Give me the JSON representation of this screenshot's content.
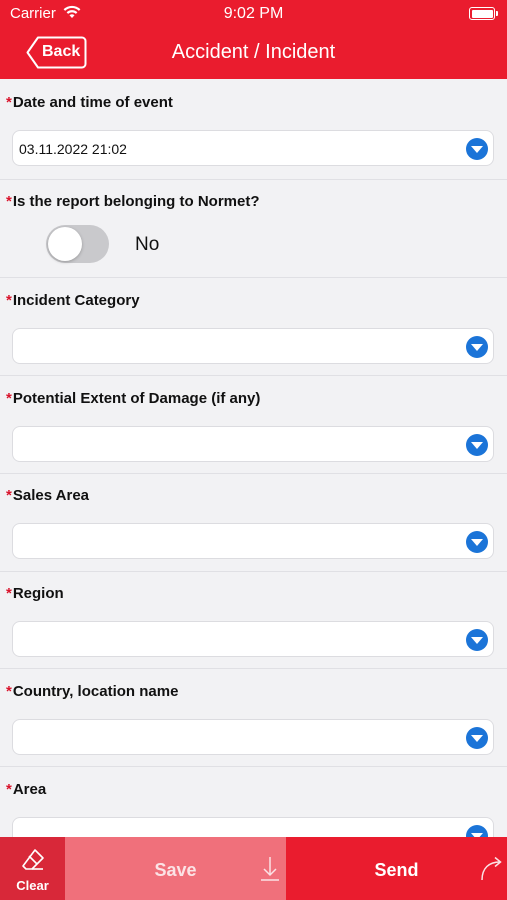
{
  "status_bar": {
    "carrier": "Carrier",
    "time": "9:02 PM"
  },
  "header": {
    "back_label": "Back",
    "title": "Accident / Incident",
    "color": "#ea1c2e"
  },
  "form": {
    "required_marker": "*",
    "date_label": "Date and time of event",
    "date_value": "03.11.2022 21:02",
    "normet_label": "Is the report belonging to Normet?",
    "normet_toggle_value": "No",
    "category_label": "Incident Category",
    "category_value": "",
    "damage_label": "Potential Extent of Damage (if any)",
    "damage_value": "",
    "sales_area_label": "Sales Area",
    "sales_area_value": "",
    "region_label": "Region",
    "region_value": "",
    "country_label": "Country, location name",
    "country_value": "",
    "area_label": "Area",
    "area_value": ""
  },
  "bottom_bar": {
    "clear_label": "Clear",
    "save_label": "Save",
    "send_label": "Send"
  },
  "icons": {
    "wifi": "wifi-icon",
    "battery": "battery-icon",
    "dropdown": "chevron-down-circle-icon",
    "clear": "eraser-icon",
    "save": "download-arrow-icon",
    "send": "curved-arrow-icon"
  },
  "colors": {
    "accent": "#ea1c2e",
    "dropdown": "#1b74d8",
    "required": "#d9132b",
    "save_bg": "#f0707b",
    "clear_bg": "#d82839"
  }
}
